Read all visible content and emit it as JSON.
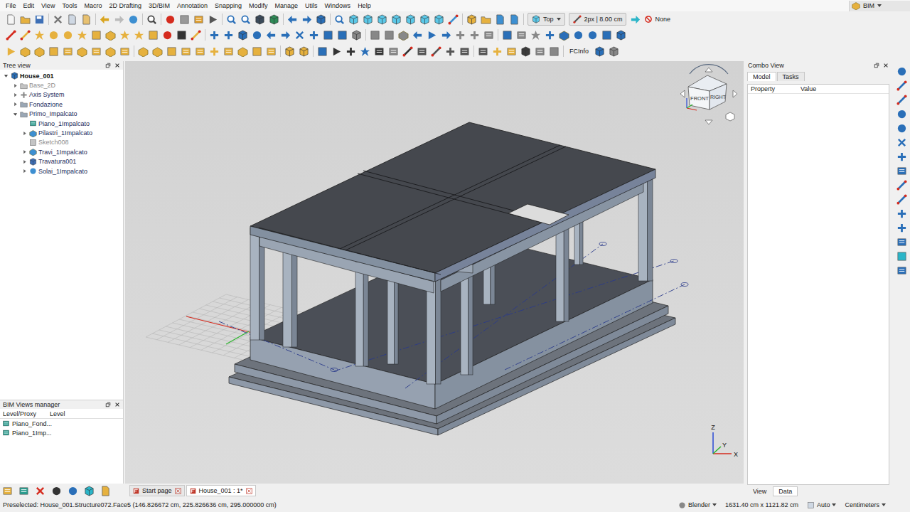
{
  "menu_bar": {
    "items": [
      "File",
      "Edit",
      "View",
      "Tools",
      "Macro",
      "2D Drafting",
      "3D/BIM",
      "Annotation",
      "Snapping",
      "Modify",
      "Manage",
      "Utils",
      "Windows",
      "Help"
    ],
    "workbench": "BIM"
  },
  "toolbar": {
    "view": "Top",
    "line_style": "2px | 8.00 cm",
    "working_plane": "None",
    "fcinfo": "FCInfo"
  },
  "tree_view": {
    "title": "Tree view",
    "items": [
      {
        "label": "House_001",
        "depth": 0,
        "kind": "document",
        "expandable": true,
        "expanded": true,
        "hidden": false,
        "active": true,
        "selected": false
      },
      {
        "label": "Base_2D",
        "depth": 1,
        "kind": "folder",
        "expandable": true,
        "expanded": false,
        "hidden": true,
        "active": false,
        "selected": false
      },
      {
        "label": "Axis System",
        "depth": 1,
        "kind": "axis",
        "expandable": true,
        "expanded": false,
        "hidden": false,
        "active": false,
        "selected": false
      },
      {
        "label": "Fondazione",
        "depth": 1,
        "kind": "folder",
        "expandable": true,
        "expanded": false,
        "hidden": false,
        "active": false,
        "selected": false
      },
      {
        "label": "Primo_Impalcato",
        "depth": 1,
        "kind": "folder",
        "expandable": true,
        "expanded": true,
        "hidden": false,
        "active": false,
        "selected": false
      },
      {
        "label": "Piano_1Impalcato",
        "depth": 2,
        "kind": "level",
        "expandable": false,
        "expanded": false,
        "hidden": false,
        "active": false,
        "selected": false
      },
      {
        "label": "Pilastri_1Impalcato",
        "depth": 2,
        "kind": "structure",
        "expandable": true,
        "expanded": false,
        "hidden": false,
        "active": false,
        "selected": false
      },
      {
        "label": "Sketch008",
        "depth": 2,
        "kind": "sketch",
        "expandable": false,
        "expanded": false,
        "hidden": true,
        "active": false,
        "selected": false
      },
      {
        "label": "Travi_1Impalcato",
        "depth": 2,
        "kind": "structure",
        "expandable": true,
        "expanded": false,
        "hidden": false,
        "active": false,
        "selected": false
      },
      {
        "label": "Travatura001",
        "depth": 2,
        "kind": "truss",
        "expandable": true,
        "expanded": false,
        "hidden": false,
        "active": false,
        "selected": false
      },
      {
        "label": "Solai_1Impalcato",
        "depth": 2,
        "kind": "slab",
        "expandable": true,
        "expanded": false,
        "hidden": false,
        "active": false,
        "selected": false
      }
    ]
  },
  "views_manager": {
    "title": "BIM Views manager",
    "columns": [
      "Level/Proxy",
      "Level"
    ],
    "rows": [
      {
        "label": "Piano_Fond...",
        "selected": false
      },
      {
        "label": "Piano_1Imp...",
        "selected": false
      }
    ]
  },
  "viewport": {
    "nav_cube_faces": [
      "FRONT",
      "RIGHT"
    ],
    "axes": {
      "z": "Z",
      "y": "Y",
      "x": "X"
    }
  },
  "document_tabs": [
    {
      "label": "Start page",
      "selected": false
    },
    {
      "label": "House_001 : 1*",
      "selected": true
    }
  ],
  "combo_view": {
    "title": "Combo View",
    "tabs": [
      {
        "label": "Model",
        "selected": true
      },
      {
        "label": "Tasks",
        "selected": false
      }
    ],
    "columns": [
      "Property",
      "Value"
    ],
    "bottom_tabs": [
      {
        "label": "View",
        "selected": false
      },
      {
        "label": "Data",
        "selected": true
      }
    ]
  },
  "status_bar": {
    "message": "Preselected: House_001.Structure072.Face5 (146.826672 cm, 225.826636 cm, 295.000000 cm)",
    "navigation": "Blender",
    "dimensions": "1631.40 cm x 1121.82 cm",
    "zoom_mode": "Auto",
    "units": "Centimeters"
  }
}
